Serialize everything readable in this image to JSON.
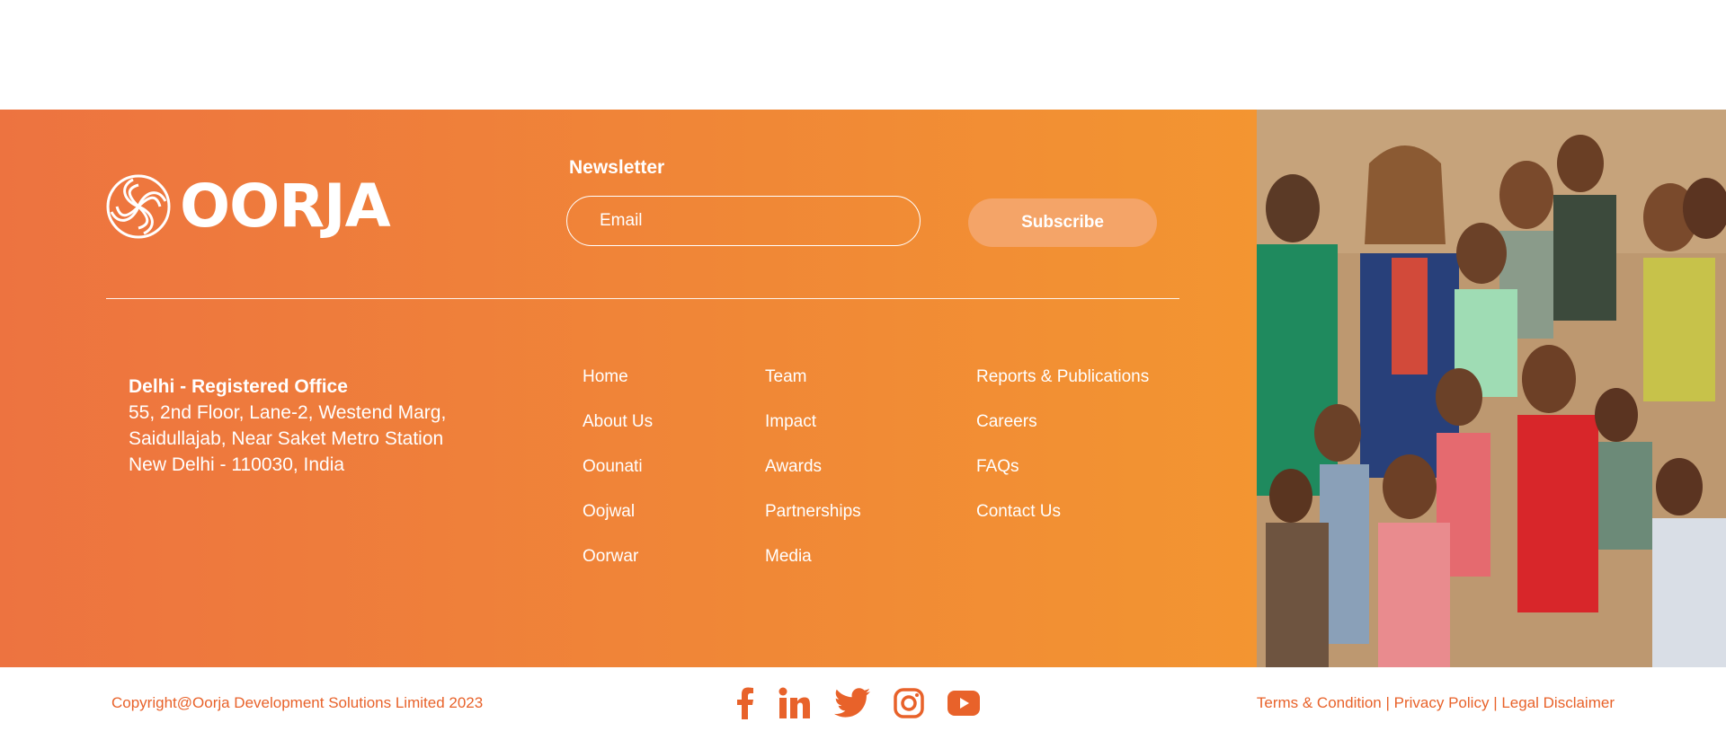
{
  "brand": {
    "name": "OORJA",
    "accent": "#ed7340",
    "accent_end": "#f39531",
    "link_color": "#e8622a"
  },
  "newsletter": {
    "label": "Newsletter",
    "email_placeholder": "Email",
    "button_label": "Subscribe"
  },
  "office": {
    "title": "Delhi - Registered Office",
    "lines": [
      "55, 2nd Floor, Lane-2, Westend Marg,",
      "Saidullajab, Near Saket Metro Station",
      "New Delhi - 110030, India"
    ]
  },
  "nav": {
    "col1": [
      "Home",
      "About Us",
      "Oounati",
      "Oojwal",
      "Oorwar"
    ],
    "col2": [
      "Team",
      "Impact",
      "Awards",
      "Partnerships",
      "Media"
    ],
    "col3": [
      "Reports & Publications",
      "Careers",
      "FAQs",
      "Contact Us"
    ]
  },
  "bottom": {
    "copyright": "Copyright@Oorja Development Solutions Limited 2023",
    "legal": [
      "Terms & Condition",
      "Privacy Policy",
      "Legal Disclaimer"
    ],
    "separator": "|"
  },
  "socials": [
    "facebook-icon",
    "linkedin-icon",
    "twitter-icon",
    "instagram-icon",
    "youtube-icon"
  ],
  "photo": {
    "description": "group-photo"
  }
}
